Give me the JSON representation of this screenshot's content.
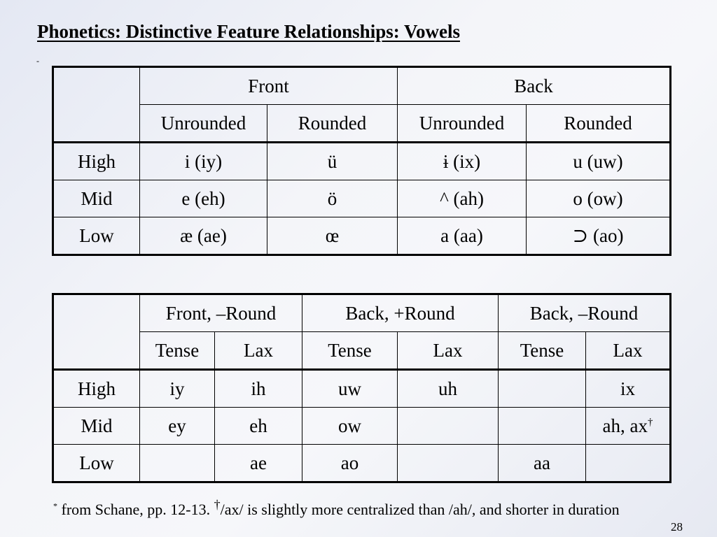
{
  "slide": {
    "title": "Phonetics: Distinctive Feature Relationships: Vowels",
    "bullet": "-",
    "page_number": "28"
  },
  "table1": {
    "groups": [
      "Front",
      "Back"
    ],
    "subheaders": [
      "Unrounded",
      "Rounded",
      "Unrounded",
      "Rounded"
    ],
    "rows": [
      {
        "label": "High",
        "cells": [
          "i  (iy)",
          "ü",
          "ɨ (ix)",
          "u (uw)"
        ]
      },
      {
        "label": "Mid",
        "cells": [
          "e (eh)",
          "ö",
          "^ (ah)",
          "o (ow)"
        ]
      },
      {
        "label": "Low",
        "cells": [
          "æ (ae)",
          "œ",
          "a  (aa)",
          "⊃ (ao)"
        ]
      }
    ]
  },
  "table2": {
    "groups": [
      "Front, –Round",
      "Back, +Round",
      "Back, –Round"
    ],
    "subheaders": [
      "Tense",
      "Lax",
      "Tense",
      "Lax",
      "Tense",
      "Lax"
    ],
    "rows": [
      {
        "label": "High",
        "cells": [
          "iy",
          "ih",
          "uw",
          "uh",
          "",
          "ix"
        ]
      },
      {
        "label": "Mid",
        "cells": [
          "ey",
          "eh",
          "ow",
          "",
          "",
          "ah, ax"
        ]
      },
      {
        "label": "Low",
        "cells": [
          "",
          "ae",
          "ao",
          "",
          "aa",
          ""
        ]
      }
    ],
    "dagger_mark": "†"
  },
  "footnote": {
    "asterisk": "*",
    "source": " from Schane, pp. 12-13. ",
    "dagger": "†",
    "note": "/ax/ is slightly more centralized than /ah/, and shorter in duration"
  }
}
